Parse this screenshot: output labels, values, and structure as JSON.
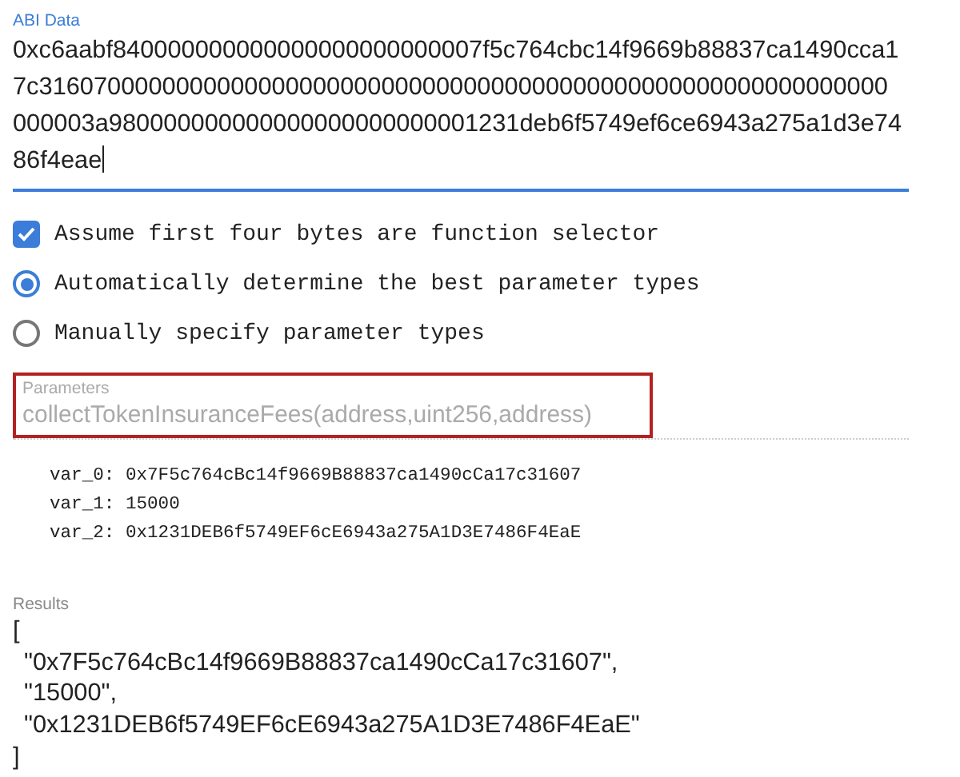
{
  "abi_data": {
    "label": "ABI Data",
    "value_lines": [
      "0xc6aabf840000000000000000000000007f5c764cbc14f9669b88837ca1490cca1",
      "7c31607000000000000000000000000000000000000000000000000000000000",
      "000003a980000000000000000000000001231deb6f5749ef6ce6943a275a1d3e74",
      "86f4eae"
    ],
    "focused": true
  },
  "options": [
    {
      "kind": "checkbox",
      "label": "Assume first four bytes are function selector",
      "checked": true
    },
    {
      "kind": "radio",
      "label": "Automatically determine the best parameter types",
      "selected": true
    },
    {
      "kind": "radio",
      "label": "Manually specify parameter types",
      "selected": false
    }
  ],
  "parameters": {
    "label": "Parameters",
    "value": "collectTokenInsuranceFees(address,uint256,address)",
    "disabled": true,
    "highlighted": true
  },
  "decoded_vars": [
    "var_0: 0x7F5c764cBc14f9669B88837ca1490cCa17c31607",
    "var_1: 15000",
    "var_2: 0x1231DEB6f5749EF6cE6943a275A1D3E7486F4EaE"
  ],
  "results": {
    "label": "Results",
    "lines": [
      "[",
      "\"0x7F5c764cBc14f9669B88837ca1490cCa17c31607\",",
      "\"15000\",",
      "\"0x1231DEB6f5749EF6cE6943a275A1D3E7486F4EaE\"",
      "]"
    ]
  }
}
